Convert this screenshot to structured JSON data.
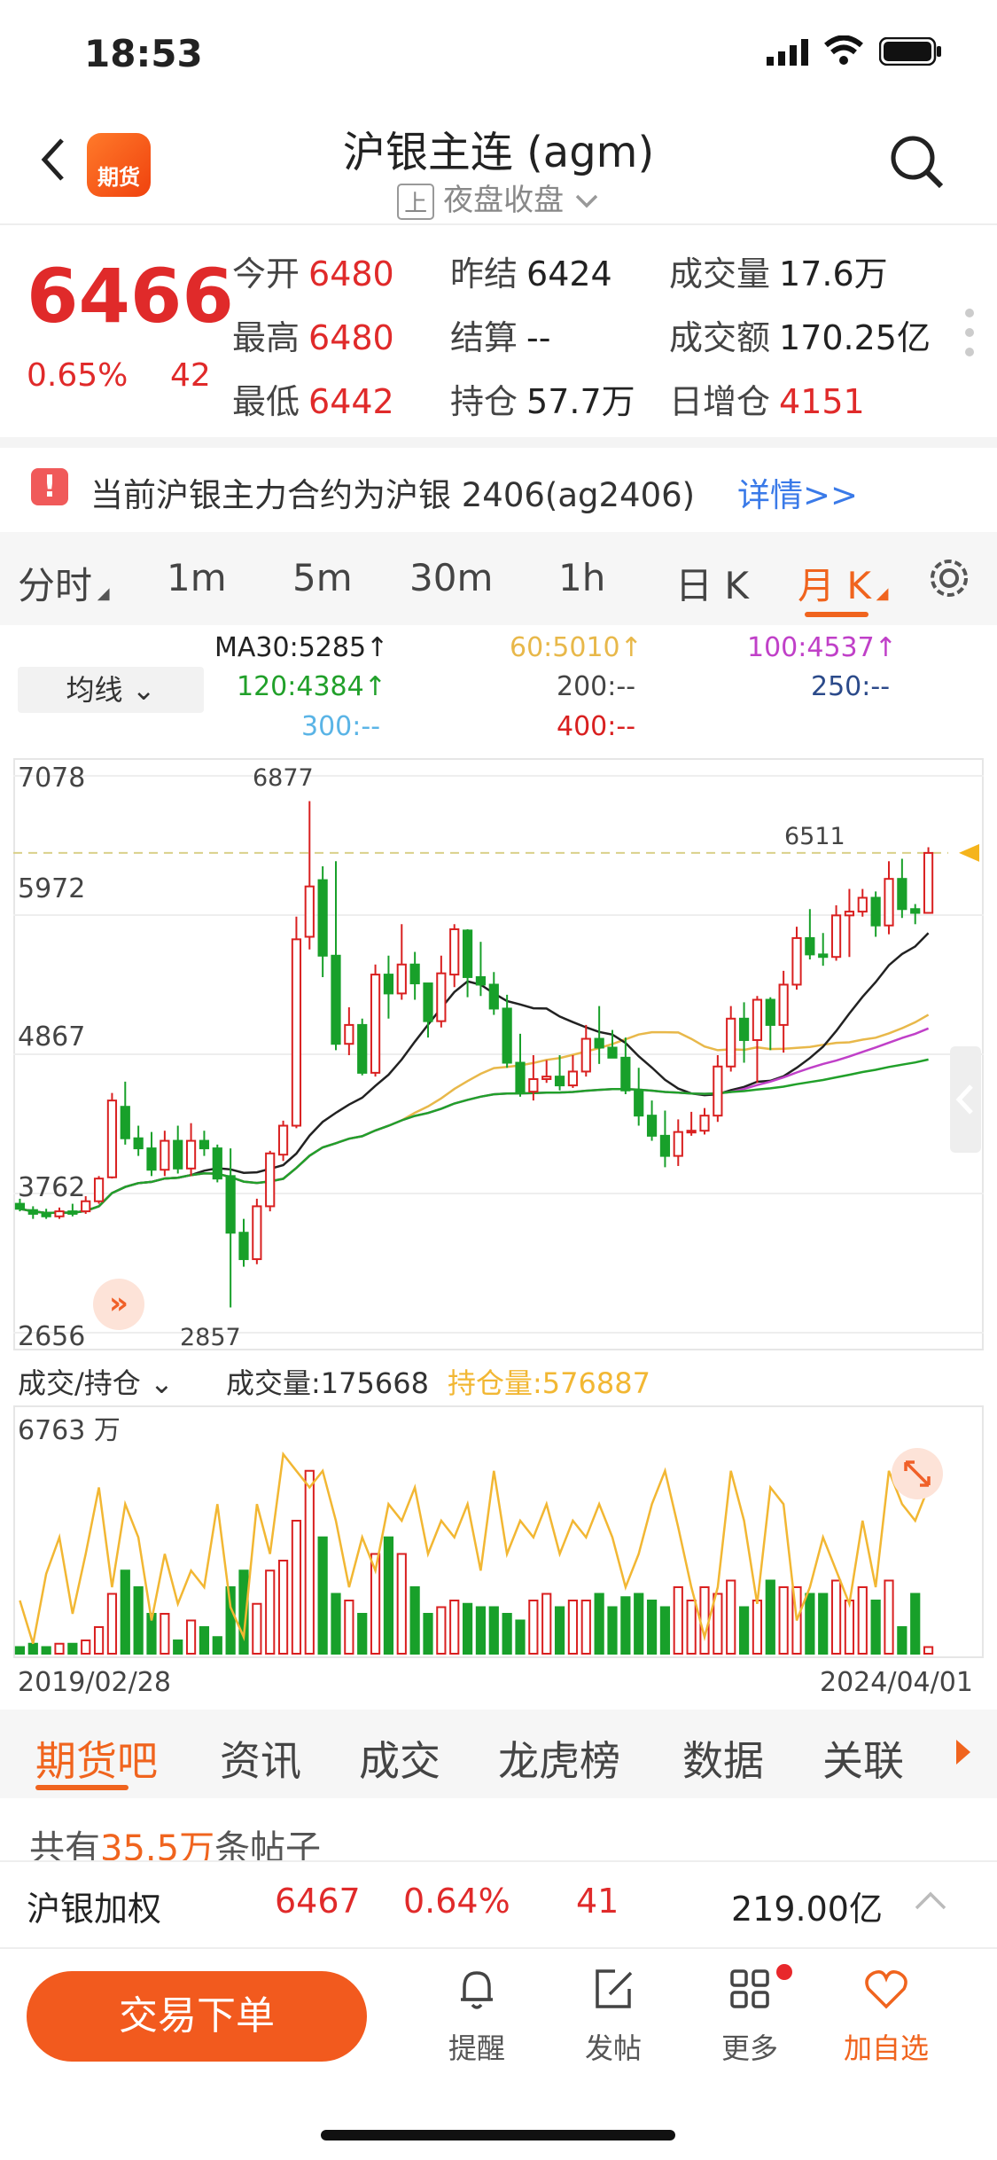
{
  "status": {
    "time": "18:53"
  },
  "header": {
    "logo_text": "期货",
    "title": "沪银主连 (agm)",
    "session_tag": "上",
    "session_text": "夜盘收盘"
  },
  "quote": {
    "price": "6466",
    "change_pct": "0.65%",
    "change": "42",
    "fields": [
      {
        "label": "今开",
        "value": "6480"
      },
      {
        "label": "最高",
        "value": "6480"
      },
      {
        "label": "最低",
        "value": "6442"
      },
      {
        "label": "昨结",
        "value": "6424"
      },
      {
        "label": "结算",
        "value": "--"
      },
      {
        "label": "持仓",
        "value": "57.7万"
      },
      {
        "label": "成交量",
        "value": "17.6万"
      },
      {
        "label": "成交额",
        "value": "170.25亿"
      },
      {
        "label": "日增仓",
        "value": "4151"
      }
    ]
  },
  "notice": {
    "text": "当前沪银主力合约为沪银 2406(ag2406)",
    "link": "详情>>"
  },
  "period_tabs": [
    "分时",
    "1m",
    "5m",
    "30m",
    "1h",
    "日 K",
    "月 K"
  ],
  "active_period": "月 K",
  "ma_legend": {
    "selector": "均线",
    "items": [
      {
        "text": "MA30:5285↑",
        "color": "#222222"
      },
      {
        "text": "60:5010↑",
        "color": "#e8b84a"
      },
      {
        "text": "100:4537↑",
        "color": "#c040c8"
      },
      {
        "text": "120:4384↑",
        "color": "#21a02a"
      },
      {
        "text": "200:--",
        "color": "#444444"
      },
      {
        "text": "250:--",
        "color": "#2b4a8a"
      },
      {
        "text": "300:--",
        "color": "#5ab4e6"
      },
      {
        "text": "400:--",
        "color": "#d92020"
      }
    ]
  },
  "price_axis": {
    "labels": [
      "7078",
      "5972",
      "4867",
      "3762",
      "2656"
    ]
  },
  "annotations": {
    "high": "6877",
    "low": "2857",
    "last": "6511"
  },
  "volume_panel": {
    "selector": "成交/持仓",
    "volume_label": "成交量:175668",
    "oi_label": "持仓量:576887",
    "max_label": "6763 万"
  },
  "dates": {
    "start": "2019/02/28",
    "end": "2024/04/01"
  },
  "chart_data": {
    "type": "candlestick",
    "period": "monthly",
    "ylim": [
      2656,
      7078
    ],
    "colors": {
      "up": "#d92020",
      "down": "#18a02a",
      "ma30": "#222222",
      "ma60": "#e8b84a",
      "ma100": "#c040c8",
      "ma120": "#21a02a",
      "oi": "#f2b733"
    },
    "candles": [
      [
        3680,
        3640,
        3720,
        3620
      ],
      [
        3630,
        3600,
        3660,
        3560
      ],
      [
        3600,
        3580,
        3640,
        3560
      ],
      [
        3580,
        3620,
        3650,
        3560
      ],
      [
        3620,
        3600,
        3680,
        3580
      ],
      [
        3620,
        3700,
        3740,
        3600
      ],
      [
        3700,
        3880,
        3900,
        3680
      ],
      [
        3890,
        4500,
        4560,
        3880
      ],
      [
        4450,
        4200,
        4650,
        4150
      ],
      [
        4200,
        4120,
        4300,
        4060
      ],
      [
        4120,
        3950,
        4250,
        3900
      ],
      [
        3950,
        4180,
        4260,
        3900
      ],
      [
        4180,
        3960,
        4300,
        3920
      ],
      [
        3960,
        4180,
        4320,
        3900
      ],
      [
        4180,
        4120,
        4260,
        4060
      ],
      [
        4120,
        3880,
        4150,
        3850
      ],
      [
        3900,
        3450,
        4120,
        2857
      ],
      [
        3450,
        3240,
        3560,
        3180
      ],
      [
        3240,
        3660,
        3720,
        3200
      ],
      [
        3660,
        4080,
        4100,
        3620
      ],
      [
        4070,
        4300,
        4340,
        4020
      ],
      [
        4300,
        5780,
        5960,
        4280
      ],
      [
        5800,
        6200,
        6877,
        5700
      ],
      [
        6250,
        5650,
        6360,
        5480
      ],
      [
        5650,
        4950,
        6400,
        4900
      ],
      [
        4950,
        5100,
        5240,
        4860
      ],
      [
        5100,
        4720,
        5150,
        4700
      ],
      [
        4720,
        5500,
        5580,
        4690
      ],
      [
        5500,
        5350,
        5650,
        5150
      ],
      [
        5350,
        5580,
        5900,
        5300
      ],
      [
        5580,
        5430,
        5680,
        5300
      ],
      [
        5430,
        5130,
        5420,
        5000
      ],
      [
        5130,
        5510,
        5650,
        5080
      ],
      [
        5500,
        5860,
        5900,
        5400
      ],
      [
        5850,
        5480,
        5860,
        5320
      ],
      [
        5480,
        5420,
        5760,
        5330
      ],
      [
        5420,
        5230,
        5520,
        5180
      ],
      [
        5230,
        4800,
        5340,
        4760
      ],
      [
        4800,
        4570,
        5030,
        4530
      ],
      [
        4570,
        4670,
        4860,
        4500
      ],
      [
        4670,
        4690,
        4820,
        4640
      ],
      [
        4690,
        4620,
        4860,
        4580
      ],
      [
        4620,
        4730,
        4860,
        4600
      ],
      [
        4730,
        4990,
        5100,
        4690
      ],
      [
        4990,
        4920,
        5250,
        4790
      ],
      [
        4920,
        4840,
        5060,
        4840
      ],
      [
        4840,
        4580,
        5000,
        4550
      ],
      [
        4580,
        4380,
        4760,
        4300
      ],
      [
        4380,
        4220,
        4500,
        4180
      ],
      [
        4220,
        4060,
        4420,
        3970
      ],
      [
        4060,
        4250,
        4350,
        3980
      ],
      [
        4250,
        4260,
        4410,
        4220
      ],
      [
        4260,
        4380,
        4440,
        4230
      ],
      [
        4380,
        4770,
        4860,
        4330
      ],
      [
        4770,
        5150,
        5250,
        4730
      ],
      [
        5150,
        4980,
        5280,
        4800
      ],
      [
        4980,
        5300,
        5330,
        4640
      ],
      [
        5300,
        5100,
        5320,
        4900
      ],
      [
        5100,
        5420,
        5530,
        4880
      ],
      [
        5420,
        5790,
        5880,
        5380
      ],
      [
        5790,
        5660,
        6020,
        5620
      ],
      [
        5660,
        5640,
        5830,
        5570
      ],
      [
        5640,
        5970,
        6050,
        5610
      ],
      [
        5970,
        6000,
        6180,
        5640
      ],
      [
        6000,
        6110,
        6180,
        5960
      ],
      [
        6110,
        5890,
        6160,
        5800
      ],
      [
        5890,
        6260,
        6400,
        5820
      ],
      [
        6260,
        6020,
        6420,
        5950
      ],
      [
        6020,
        5990,
        6060,
        5900
      ],
      [
        5990,
        6466,
        6511,
        5990
      ]
    ],
    "volume": [
      2,
      3,
      2,
      3,
      3,
      4,
      8,
      18,
      25,
      20,
      12,
      12,
      4,
      10,
      8,
      5,
      20,
      25,
      15,
      25,
      28,
      40,
      55,
      35,
      18,
      16,
      12,
      30,
      35,
      30,
      20,
      12,
      14,
      16,
      15,
      14,
      14,
      12,
      10,
      16,
      18,
      14,
      16,
      16,
      18,
      14,
      17,
      18,
      16,
      14,
      20,
      16,
      20,
      18,
      22,
      14,
      16,
      22,
      20,
      20,
      18,
      18,
      22,
      16,
      20,
      16,
      22,
      8,
      18,
      2
    ],
    "open_interest": [
      16,
      3,
      24,
      35,
      12,
      30,
      50,
      20,
      45,
      35,
      10,
      30,
      15,
      25,
      20,
      45,
      14,
      5,
      45,
      30,
      60,
      55,
      50,
      55,
      40,
      20,
      35,
      25,
      45,
      40,
      50,
      30,
      40,
      35,
      45,
      25,
      55,
      30,
      40,
      35,
      45,
      30,
      40,
      35,
      45,
      35,
      20,
      30,
      45,
      55,
      38,
      20,
      5,
      20,
      55,
      40,
      15,
      50,
      45,
      10,
      20,
      35,
      25,
      15,
      40,
      20,
      55,
      45,
      40,
      50
    ]
  },
  "tabs_bottom": [
    "期货吧",
    "资讯",
    "成交",
    "龙虎榜",
    "数据",
    "关联"
  ],
  "posts": {
    "prefix": "共有",
    "count": "35.5万",
    "suffix": "条帖子"
  },
  "weighted": {
    "name": "沪银加权",
    "price": "6467",
    "pct": "0.64%",
    "change": "41",
    "amount": "219.00亿"
  },
  "bottom_bar": {
    "trade_label": "交易下单",
    "items": [
      {
        "label": "提醒",
        "icon": "bell-icon"
      },
      {
        "label": "发帖",
        "icon": "compose-icon"
      },
      {
        "label": "更多",
        "icon": "grid-icon"
      },
      {
        "label": "加自选",
        "icon": "heart-icon"
      }
    ]
  }
}
